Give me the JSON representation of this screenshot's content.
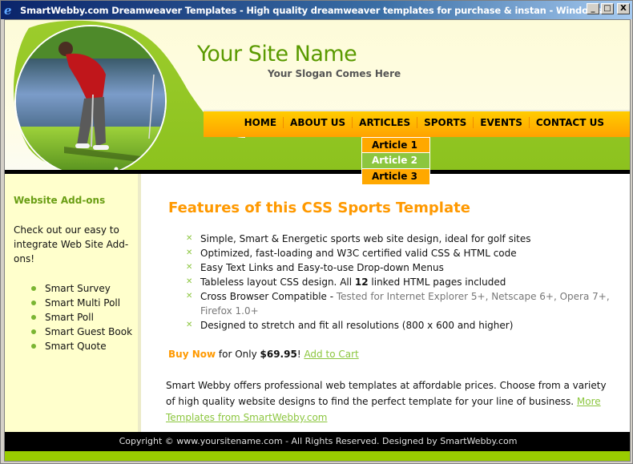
{
  "window": {
    "title": "SmartWebby.com Dreamweaver Templates - High quality dreamweaver templates for purchase & instan - Windows Interne...",
    "app_icon": "ie-icon",
    "controls": {
      "minimize": "_",
      "maximize": "□",
      "close": "X"
    }
  },
  "header": {
    "site_name": "Your Site Name",
    "slogan": "Your Slogan Comes Here",
    "photo_alt": "golfer-putting-photo"
  },
  "nav": {
    "items": [
      {
        "label": "HOME"
      },
      {
        "label": "ABOUT US"
      },
      {
        "label": "ARTICLES"
      },
      {
        "label": "SPORTS"
      },
      {
        "label": "EVENTS"
      },
      {
        "label": "CONTACT US"
      }
    ],
    "dropdown": {
      "parent": "ARTICLES",
      "items": [
        {
          "label": "Article 1"
        },
        {
          "label": "Article 2",
          "active": true
        },
        {
          "label": "Article 3"
        }
      ]
    }
  },
  "sidebar": {
    "title": "Website Add-ons",
    "text": "Check out our easy to integrate Web Site Add-ons!",
    "items": [
      {
        "label": "Smart Survey"
      },
      {
        "label": "Smart Multi Poll"
      },
      {
        "label": "Smart Poll"
      },
      {
        "label": "Smart Guest Book"
      },
      {
        "label": "Smart Quote"
      }
    ]
  },
  "main": {
    "title": "Features of this CSS Sports Template",
    "features": [
      {
        "text": "Simple, Smart & Energetic sports web site design, ideal for golf sites"
      },
      {
        "text": "Optimized, fast-loading and W3C certified valid CSS & HTML code"
      },
      {
        "text": "Easy Text Links and Easy-to-use Drop-down Menus"
      },
      {
        "pre": "Tableless layout CSS design. All ",
        "bold": "12",
        "post": " linked HTML pages included"
      },
      {
        "pre": "Cross Browser Compatible - ",
        "muted": "Tested for Internet Explorer 5+, Netscape 6+, Opera 7+, Firefox 1.0+"
      },
      {
        "text": "Designed to stretch and fit all resolutions (800 x 600 and higher)"
      }
    ],
    "buy": {
      "buy_now": "Buy Now",
      "for_only": " for Only ",
      "price": "$69.95",
      "bang": "! ",
      "add_to_cart": "Add to Cart"
    },
    "paragraph": {
      "text": "Smart Webby offers professional web templates at affordable prices. Choose from a variety of high quality website designs to find the perfect template for your line of business. ",
      "link": "More Templates from SmartWebby.com"
    }
  },
  "footer": {
    "text": "Copyright © www.yoursitename.com - All Rights Reserved. Designed by SmartWebby.com"
  },
  "colors": {
    "accent_green": "#8cc63f",
    "site_name_green": "#5a9a00",
    "accent_orange": "#ff9900",
    "nav_orange": "#ffa800",
    "sidebar_bg": "#ffffcc",
    "footer_bg": "#000000",
    "footer_band": "#99cc00"
  }
}
